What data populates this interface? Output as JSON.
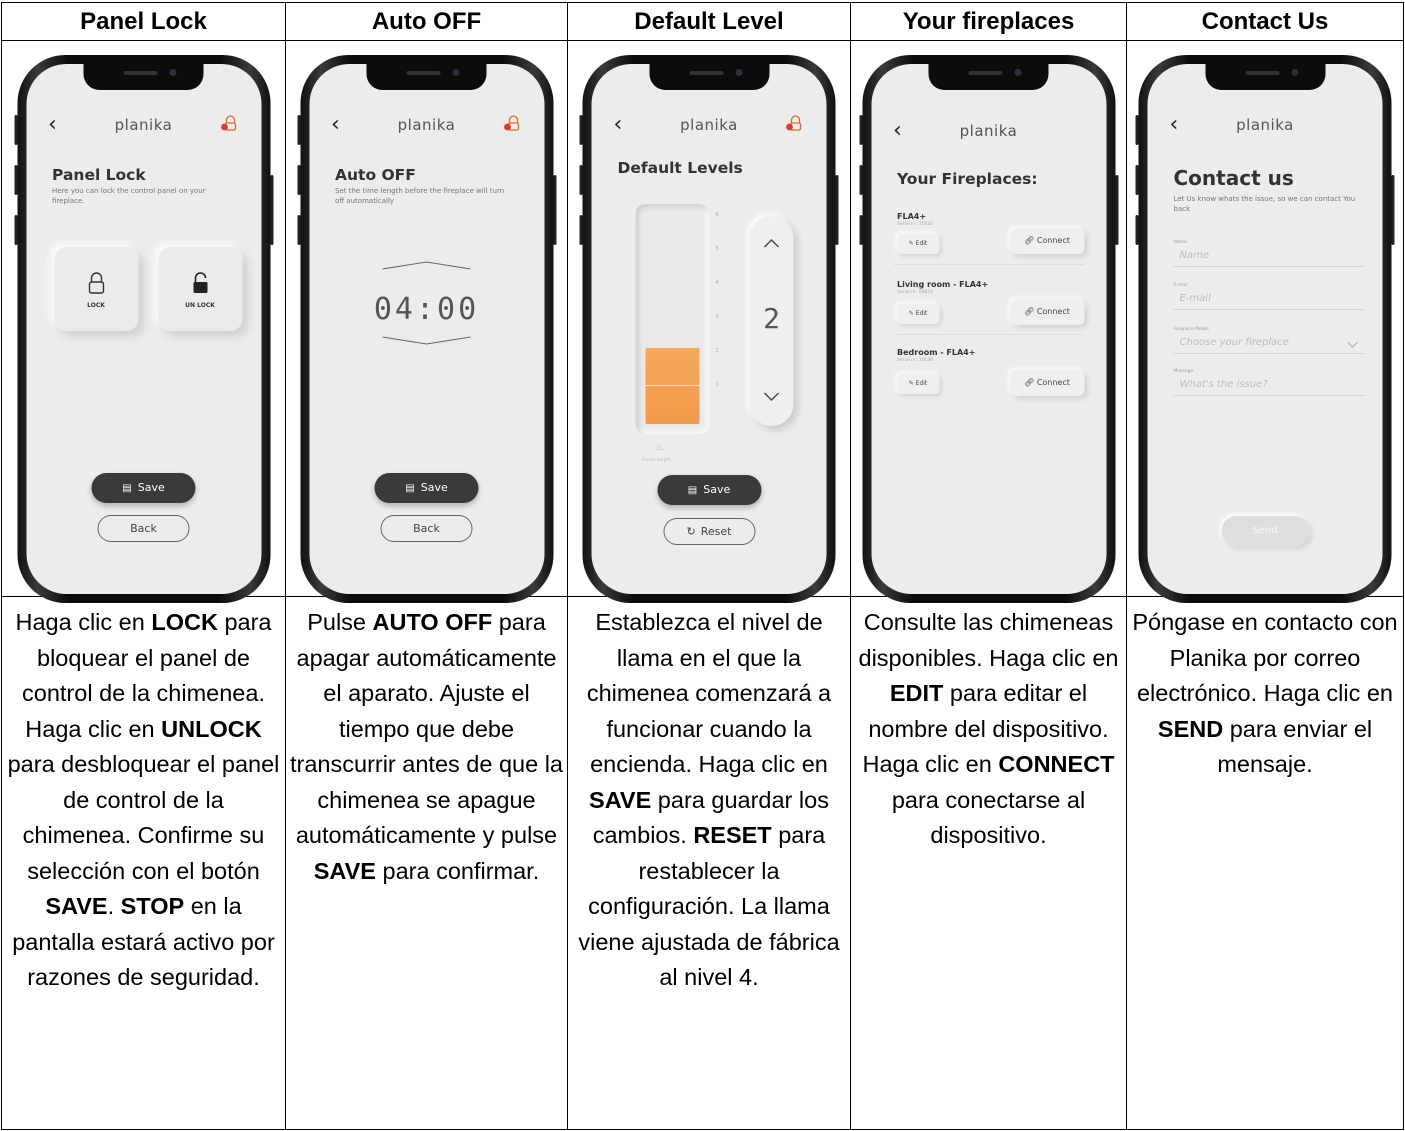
{
  "columns": [
    {
      "header": "Panel Lock",
      "screen": {
        "brand": "planika",
        "title": "Panel Lock",
        "subtitle": "Here you can lock the control panel on your fireplace.",
        "lock_label": "LOCK",
        "unlock_label": "UN LOCK",
        "save": "Save",
        "back": "Back"
      },
      "desc": [
        {
          "t": "Haga clic en "
        },
        {
          "b": "LOCK"
        },
        {
          "t": " para bloquear el panel de control de la chimenea. Haga clic en "
        },
        {
          "b": "UNLOCK"
        },
        {
          "t": " para desbloquear el panel de control de la chimenea. Confirme su selección con el botón "
        },
        {
          "b": "SAVE"
        },
        {
          "t": ". "
        },
        {
          "b": "STOP"
        },
        {
          "t": " en la pantalla estará activo por razones de seguridad."
        }
      ]
    },
    {
      "header": "Auto OFF",
      "screen": {
        "brand": "planika",
        "title": "Auto OFF",
        "subtitle": "Set the time length before the fireplace will turn off automatically",
        "time": "04:00",
        "save": "Save",
        "back": "Back"
      },
      "desc": [
        {
          "t": "Pulse "
        },
        {
          "b": "AUTO OFF"
        },
        {
          "t": " para apagar automáticamente el aparato. Ajuste el tiempo que debe transcurrir antes de que la chimenea se apague automáticamente y pulse "
        },
        {
          "b": "SAVE"
        },
        {
          "t": " para confirmar."
        }
      ]
    },
    {
      "header": "Default Level",
      "screen": {
        "brand": "planika",
        "title": "Default Levels",
        "level": "2",
        "level_fraction": 0.36,
        "ticks": [
          "6",
          "5",
          "4",
          "3",
          "2",
          "1"
        ],
        "gauge_caption": "Flame height",
        "save": "Save",
        "reset": "Reset"
      },
      "desc": [
        {
          "t": "Establezca el nivel de llama en el que la chimenea comenzará a funcionar cuando la encienda. Haga clic en "
        },
        {
          "b": "SAVE"
        },
        {
          "t": " para guardar los cambios. "
        },
        {
          "b": "RESET"
        },
        {
          "t": " para restablecer la configuración. La llama viene ajustada de fábrica al nivel 4."
        }
      ]
    },
    {
      "header": "Your fireplaces",
      "screen": {
        "brand": "planika",
        "title": "Your Fireplaces:",
        "items": [
          {
            "name": "FLA4+",
            "serial": "Serial nr: 10010",
            "edit": "Edit",
            "connect": "Connect"
          },
          {
            "name": "Living room - FLA4+",
            "serial": "Serial nr: 09614",
            "edit": "Edit",
            "connect": "Connect"
          },
          {
            "name": "Bedroom - FLA4+",
            "serial": "Serial nr: 10138",
            "edit": "Edit",
            "connect": "Connect"
          }
        ]
      },
      "desc": [
        {
          "t": "Consulte las chimeneas disponibles. Haga clic en "
        },
        {
          "b": "EDIT"
        },
        {
          "t": " para editar el nombre del dispositivo. Haga clic en "
        },
        {
          "b": "CONNECT"
        },
        {
          "t": " para conectarse al dispositivo."
        }
      ]
    },
    {
      "header": "Contact Us",
      "screen": {
        "brand": "planika",
        "title": "Contact us",
        "subtitle": "Let Us know whats the issue, so we can contact You back",
        "name_label": "Name",
        "name_ph": "Name",
        "email_label": "E-mail",
        "email_ph": "E-mail",
        "model_label": "Fireplace Model",
        "model_ph": "Choose your fireplace",
        "message_label": "Message",
        "message_ph": "What's the issue?",
        "send": "Send"
      },
      "desc": [
        {
          "t": "Póngase en contacto con Planika por correo electrónico. Haga clic en "
        },
        {
          "b": "SEND"
        },
        {
          "t": " para enviar el mensaje."
        }
      ]
    }
  ]
}
